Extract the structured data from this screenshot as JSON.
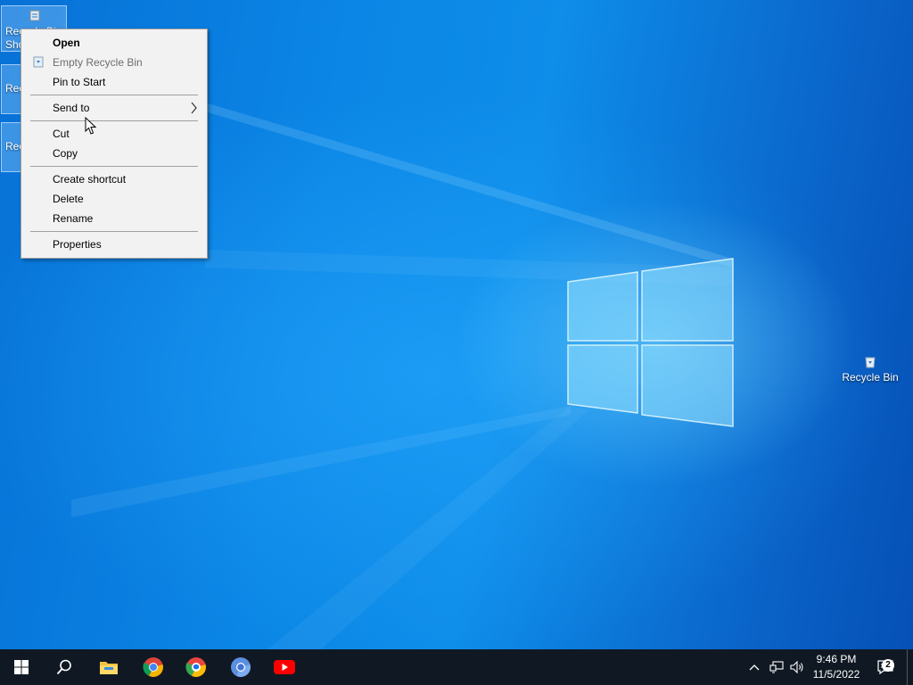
{
  "desktop": {
    "icons_left": [
      {
        "label": "Recycle Bin Shortcut"
      },
      {
        "label": "Recycle Bin Shortcut"
      },
      {
        "label": "Recycle Bin Shortcut"
      }
    ],
    "icon_right": {
      "label": "Recycle Bin"
    }
  },
  "context_menu": {
    "items": [
      {
        "label": "Open"
      },
      {
        "label": "Empty Recycle Bin"
      },
      {
        "label": "Pin to Start"
      },
      {
        "label": "Send to"
      },
      {
        "label": "Cut"
      },
      {
        "label": "Copy"
      },
      {
        "label": "Create shortcut"
      },
      {
        "label": "Delete"
      },
      {
        "label": "Rename"
      },
      {
        "label": "Properties"
      }
    ],
    "submenu_arrow": ">"
  },
  "taskbar": {
    "pinned": [
      {
        "icon": "start-windows-icon"
      },
      {
        "icon": "search-icon"
      },
      {
        "icon": "file-explorer-icon"
      },
      {
        "icon": "chrome-icon"
      },
      {
        "icon": "chrome-beta-icon"
      },
      {
        "icon": "chromium-icon"
      },
      {
        "icon": "youtube-icon"
      }
    ],
    "tray": {
      "time": "9:46 PM",
      "date": "11/5/2022",
      "notification_count": "2"
    }
  },
  "colors": {
    "taskbar": "#101923",
    "menu_bg": "#f2f2f2",
    "youtube": "#ff0000"
  }
}
